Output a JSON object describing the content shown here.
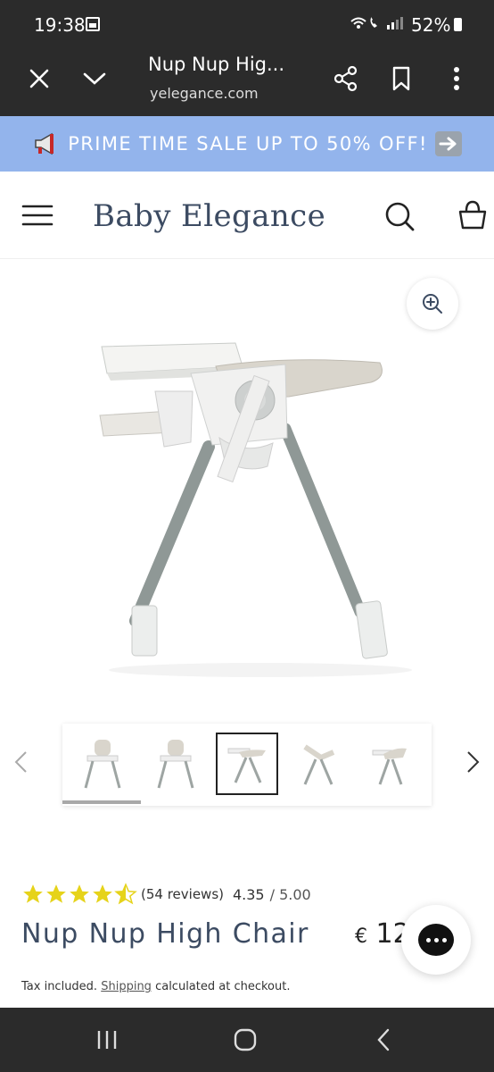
{
  "status_bar": {
    "time": "19:38",
    "battery": "52%"
  },
  "browser": {
    "page_title": "Nup Nup Hig...",
    "url": "yelegance.com"
  },
  "promo": {
    "text": "PRIME TIME SALE UP TO 50% OFF!"
  },
  "header": {
    "logo": "Baby Elegance"
  },
  "gallery": {
    "thumbnail_count": 5,
    "selected_index": 2
  },
  "product": {
    "rating_value": 4.35,
    "rating_max": 5,
    "stars_filled": 4.5,
    "reviews": "(54 reviews)",
    "score": "4.35",
    "out_of": "/ 5.00",
    "title": "Nup Nup High Chair",
    "price_currency": "€",
    "price_visible": "12",
    "tax_prefix": "Tax included.",
    "tax_link": "Shipping",
    "tax_suffix": "calculated at checkout."
  },
  "colors": {
    "promo_bg": "#93b4ec",
    "brand_text": "#3c4b62",
    "star": "#e6d31a",
    "dark_bar": "#2b2b2b"
  }
}
